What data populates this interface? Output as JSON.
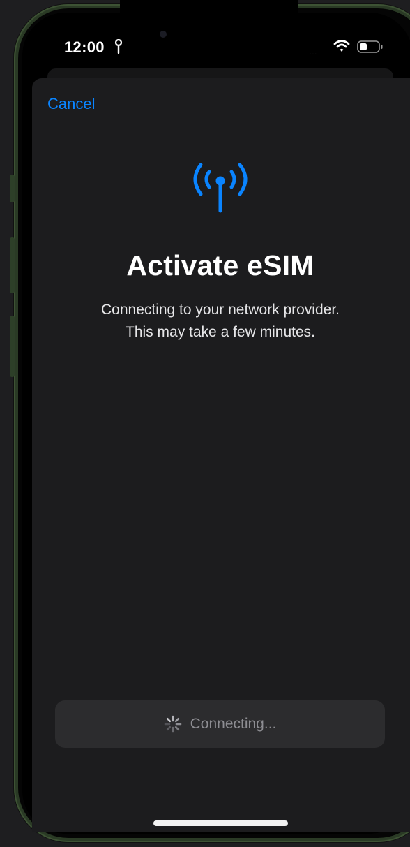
{
  "status_bar": {
    "time": "12:00",
    "location_icon": "pin-icon",
    "signal": "....",
    "wifi_icon": "wifi-icon",
    "battery_icon": "battery-icon"
  },
  "nav": {
    "cancel_label": "Cancel"
  },
  "content": {
    "icon": "antenna-icon",
    "title": "Activate eSIM",
    "subtitle_line1": "Connecting to your network provider.",
    "subtitle_line2": "This may take a few minutes."
  },
  "footer": {
    "button_label": "Connecting...",
    "button_icon": "spinner-icon",
    "button_enabled": false
  },
  "colors": {
    "accent": "#0a84ff",
    "sheet_background": "#1c1c1e",
    "button_background": "#2c2c2e",
    "button_text": "#8d8d92"
  }
}
